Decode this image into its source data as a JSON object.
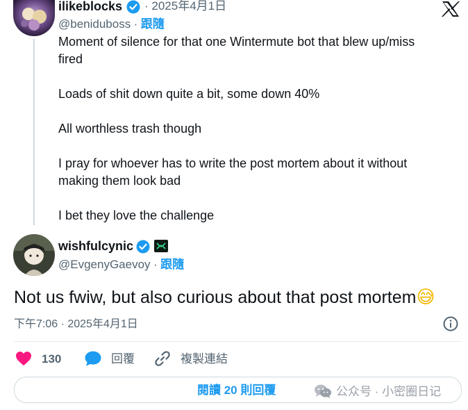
{
  "parent_tweet": {
    "display_name": "ilikeblocks",
    "timestamp": "· 2025年4月1日",
    "handle": "@beniduboss",
    "follow_label": "跟隨",
    "handle_separator": "·",
    "body": "Moment of silence for that one Wintermute bot that blew up/miss\nfired\n\nLoads of shit down quite a bit, some down 40%\n\nAll worthless trash though\n\nI pray for whoever has to write the post mortem about it without\nmaking them look bad\n\nI bet they love the challenge"
  },
  "main_tweet": {
    "display_name": "wishfulcynic",
    "handle": "@EvgenyGaevoy",
    "handle_separator": "·",
    "follow_label": "跟隨",
    "body": "Not us fwiw, but also curious about that post mortem",
    "emoji": "😅",
    "timestamp": "下午7:06 · 2025年4月1日"
  },
  "actions": {
    "like_count": "130",
    "reply_label": "回覆",
    "copy_link_label": "複製連結"
  },
  "read_replies_button": {
    "label": "閱讀 20 則回覆"
  },
  "watermark": {
    "text": "公众号 · 小密圈日记"
  },
  "colors": {
    "verified": "#1d9bf0",
    "like": "#f91880",
    "link": "#1d9bf0"
  }
}
